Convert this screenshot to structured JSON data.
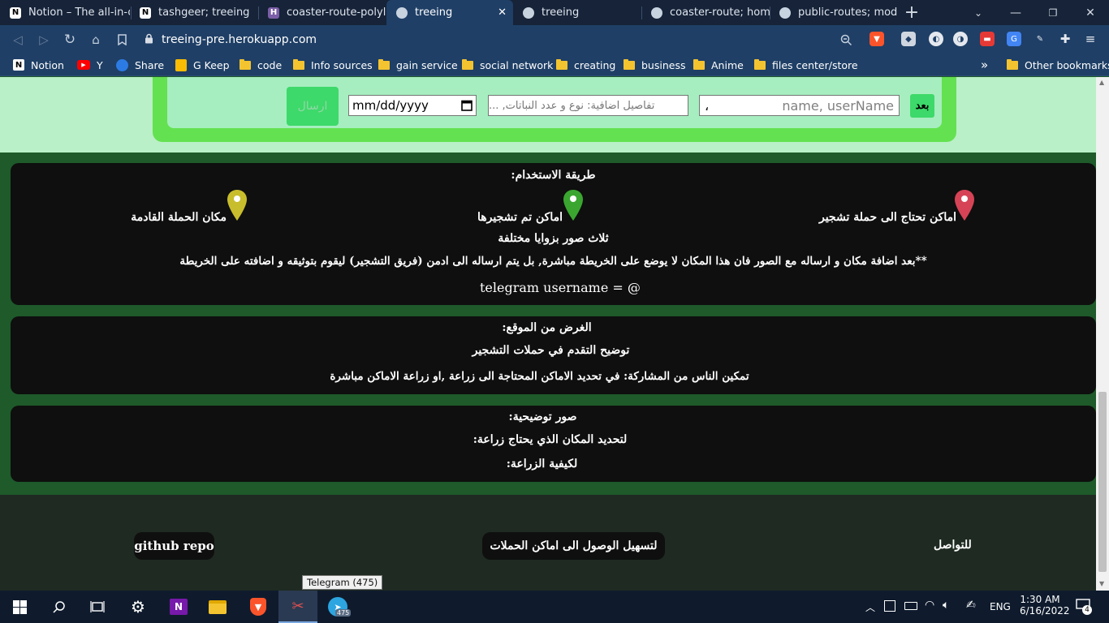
{
  "browser": {
    "tabs": [
      {
        "title": "Notion – The all-in-one",
        "icon": "notion-icon",
        "active": false
      },
      {
        "title": "tashgeer; treeing",
        "icon": "notion-icon",
        "active": false
      },
      {
        "title": "coaster-route-polyline",
        "icon": "heroku-icon",
        "active": false
      },
      {
        "title": "treeing",
        "icon": "globe-icon",
        "active": true
      },
      {
        "title": "treeing",
        "icon": "globe-icon",
        "active": false
      },
      {
        "title": "coaster-route; home",
        "icon": "globe-icon",
        "active": false
      },
      {
        "title": "public-routes; mode",
        "icon": "globe-icon",
        "active": false
      }
    ],
    "new_tab_label": "+",
    "url": "treeing-pre.herokuapp.com",
    "bookmarks": [
      {
        "label": "Notion",
        "icon": "notion-icon"
      },
      {
        "label": "Y",
        "icon": "youtube-icon"
      },
      {
        "label": "Share",
        "icon": "share-icon"
      },
      {
        "label": "G Keep",
        "icon": "keep-icon"
      },
      {
        "label": "code",
        "icon": "folder-icon"
      },
      {
        "label": "Info sources",
        "icon": "folder-icon"
      },
      {
        "label": "gain service",
        "icon": "folder-icon"
      },
      {
        "label": "social network",
        "icon": "folder-icon"
      },
      {
        "label": "creating",
        "icon": "folder-icon"
      },
      {
        "label": "business",
        "icon": "folder-icon"
      },
      {
        "label": "Anime",
        "icon": "folder-icon"
      },
      {
        "label": "files center/store",
        "icon": "folder-icon"
      }
    ],
    "bookmarks_more": "»",
    "other_bookmarks": "Other bookmarks"
  },
  "form": {
    "submit_label": "ارسال",
    "date_placeholder": "mm/dd/yyyy",
    "details_placeholder": "تفاصيل اضافية: نوع و عدد النباتات, ...",
    "user_placeholder": "name, userName",
    "user_prefix": "،",
    "next_label": "بعد"
  },
  "usage": {
    "heading": "طريقة الاستخدام:",
    "legend": [
      {
        "label": "اماكن تحتاج الى حملة تشجير",
        "color": "#d64356"
      },
      {
        "label": "اماكن تم تشجيرها",
        "color": "#3aa630"
      },
      {
        "label": "مكان الحملة القادمة",
        "color": "#c8bd2c"
      }
    ],
    "photos_note": "ثلاث صور بزوايا مختلفة",
    "admin_note": "**بعد اضافة مكان و ارساله مع الصور فان هذا المكان لا يوضع على الخريطة مباشرة, بل يتم ارساله الى ادمن (فريق التشجير) ليقوم بتوثيقه و اضافته على الخريطة",
    "telegram": "telegram username = @"
  },
  "purpose": {
    "heading": "الغرض من الموقع:",
    "line1": "توضيح التقدم في حملات التشجير",
    "line2": "تمكين الناس من المشاركة: في تحديد الاماكن المحتاجة الى زراعة ,او زراعة الاماكن مباشرة"
  },
  "illustrations": {
    "heading": "صور توضيحية:",
    "line1": "لتحديد المكان الذي يحتاج زراعة:",
    "line2": "لكيفية الزراعة:"
  },
  "footer": {
    "github": "github repo",
    "campaigns": "لتسهيل الوصول الى اماكن الحملات",
    "contact": "للتواصل"
  },
  "taskbar": {
    "tooltip": "Telegram (475)",
    "telegram_badge": "475",
    "language": "ENG",
    "time": "1:30 AM",
    "date": "6/16/2022",
    "notifications": "4"
  },
  "colors": {
    "page_bg": "#1e5a2a",
    "card_bg": "#0e0f0e",
    "form_green": "#64e150",
    "accent_green": "#3dd96a"
  }
}
